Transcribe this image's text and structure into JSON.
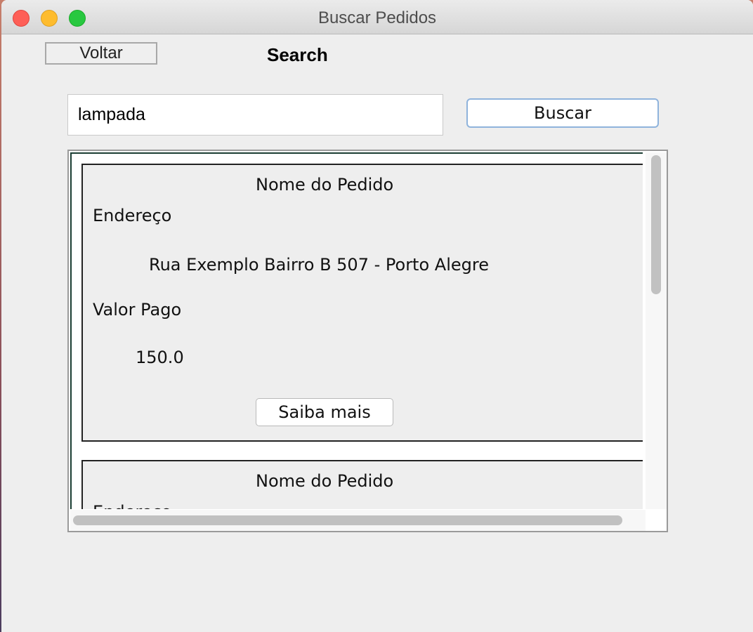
{
  "window": {
    "title": "Buscar Pedidos"
  },
  "toolbar": {
    "back_label": "Voltar",
    "heading": "Search"
  },
  "search": {
    "value": "lampada",
    "button_label": "Buscar"
  },
  "orders": [
    {
      "name": "Nome do Pedido",
      "address_label": "Endereço",
      "address": "Rua Exemplo Bairro B 507 - Porto Alegre",
      "price_label": "Valor Pago",
      "price": "150.0",
      "more_label": "Saiba mais"
    },
    {
      "name": "Nome do Pedido",
      "address_label": "Endereço"
    }
  ]
}
